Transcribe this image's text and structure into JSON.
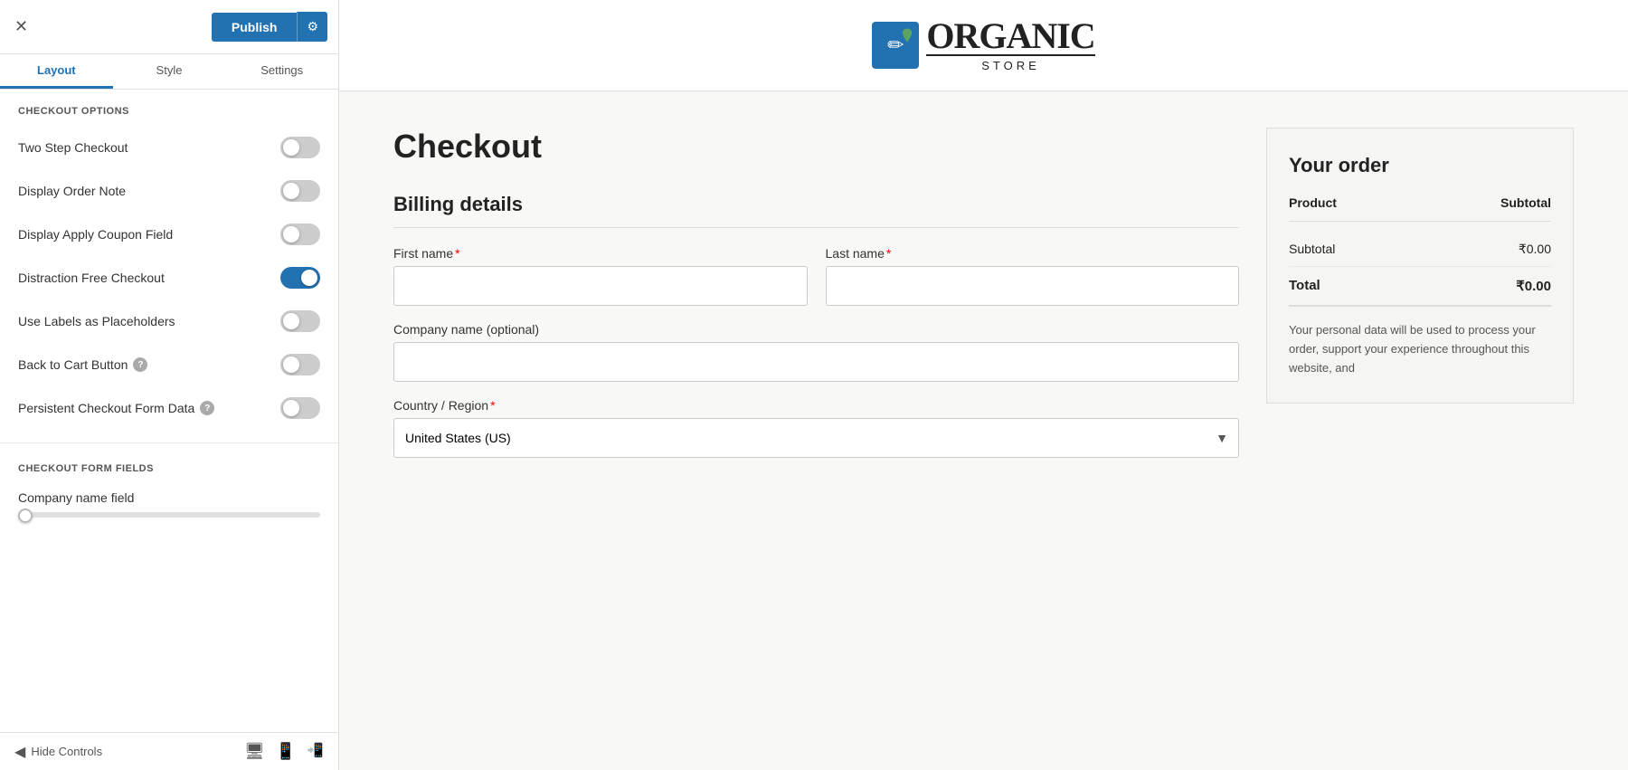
{
  "topbar": {
    "close_label": "✕",
    "publish_label": "Publish",
    "gear_label": "⚙"
  },
  "tabs": [
    {
      "label": "Layout",
      "active": true
    },
    {
      "label": "Style",
      "active": false
    },
    {
      "label": "Settings",
      "active": false
    }
  ],
  "checkout_options": {
    "section_label": "CHECKOUT OPTIONS",
    "options": [
      {
        "id": "two-step",
        "label": "Two Step Checkout",
        "checked": false,
        "has_help": false
      },
      {
        "id": "display-order-note",
        "label": "Display Order Note",
        "checked": false,
        "has_help": false
      },
      {
        "id": "display-apply-coupon",
        "label": "Display Apply Coupon Field",
        "checked": false,
        "has_help": false
      },
      {
        "id": "distraction-free",
        "label": "Distraction Free Checkout",
        "checked": true,
        "has_help": false
      },
      {
        "id": "use-labels",
        "label": "Use Labels as Placeholders",
        "checked": false,
        "has_help": false
      },
      {
        "id": "back-to-cart",
        "label": "Back to Cart Button",
        "checked": false,
        "has_help": true
      },
      {
        "id": "persistent-checkout",
        "label": "Persistent Checkout Form Data",
        "checked": false,
        "has_help": true
      }
    ]
  },
  "checkout_form_fields": {
    "section_label": "CHECKOUT FORM FIELDS",
    "company_name_field_label": "Company name field"
  },
  "bottom_bar": {
    "hide_controls_label": "Hide Controls"
  },
  "preview": {
    "logo": {
      "icon": "✎",
      "name_line1": "Organic",
      "name_line2": "STORE"
    },
    "checkout_title": "Checkout",
    "billing_title": "Billing details",
    "form": {
      "first_name_label": "First name",
      "last_name_label": "Last name",
      "company_label": "Company name (optional)",
      "country_label": "Country / Region",
      "country_value": "United States (US)"
    },
    "order_summary": {
      "title": "Your order",
      "product_col": "Product",
      "subtotal_col": "Subtotal",
      "subtotal_label": "Subtotal",
      "subtotal_value": "₹0.00",
      "total_label": "Total",
      "total_value": "₹0.00",
      "privacy_text": "Your personal data will be used to process your order, support your experience throughout this website, and"
    }
  }
}
